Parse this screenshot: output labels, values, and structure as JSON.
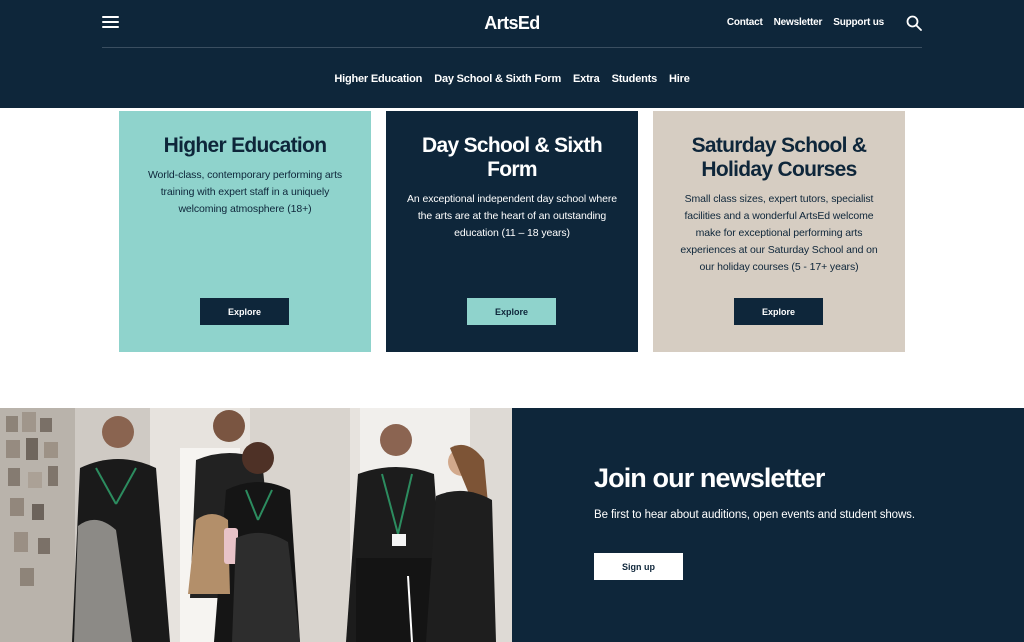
{
  "header": {
    "logo": "ArtsEd",
    "utility_nav": [
      "Contact",
      "Newsletter",
      "Support us"
    ],
    "main_nav": [
      "Higher Education",
      "Day School & Sixth Form",
      "Extra",
      "Students",
      "Hire"
    ]
  },
  "cards": [
    {
      "title": "Higher Education",
      "text": "World-class, contemporary performing arts training with expert staff in a uniquely welcoming atmosphere (18+)",
      "button": "Explore",
      "bg_color": "#8fd3cc"
    },
    {
      "title": "Day School & Sixth Form",
      "text": "An exceptional independent day school where the arts are at the heart of an outstanding education (11 – 18 years)",
      "button": "Explore",
      "bg_color": "#0e263a"
    },
    {
      "title": "Saturday School & Holiday Courses",
      "text": "Small class sizes, expert tutors, specialist facilities and a wonderful ArtsEd welcome make for exceptional performing arts experiences at our Saturday School and on our holiday courses (5 - 17+ years)",
      "button": "Explore",
      "bg_color": "#d6cdc2"
    }
  ],
  "newsletter": {
    "title": "Join our newsletter",
    "text": "Be first to hear about auditions, open events and student shows.",
    "button": "Sign up"
  },
  "colors": {
    "navy": "#0e263a",
    "teal": "#8fd3cc",
    "beige": "#d6cdc2"
  }
}
